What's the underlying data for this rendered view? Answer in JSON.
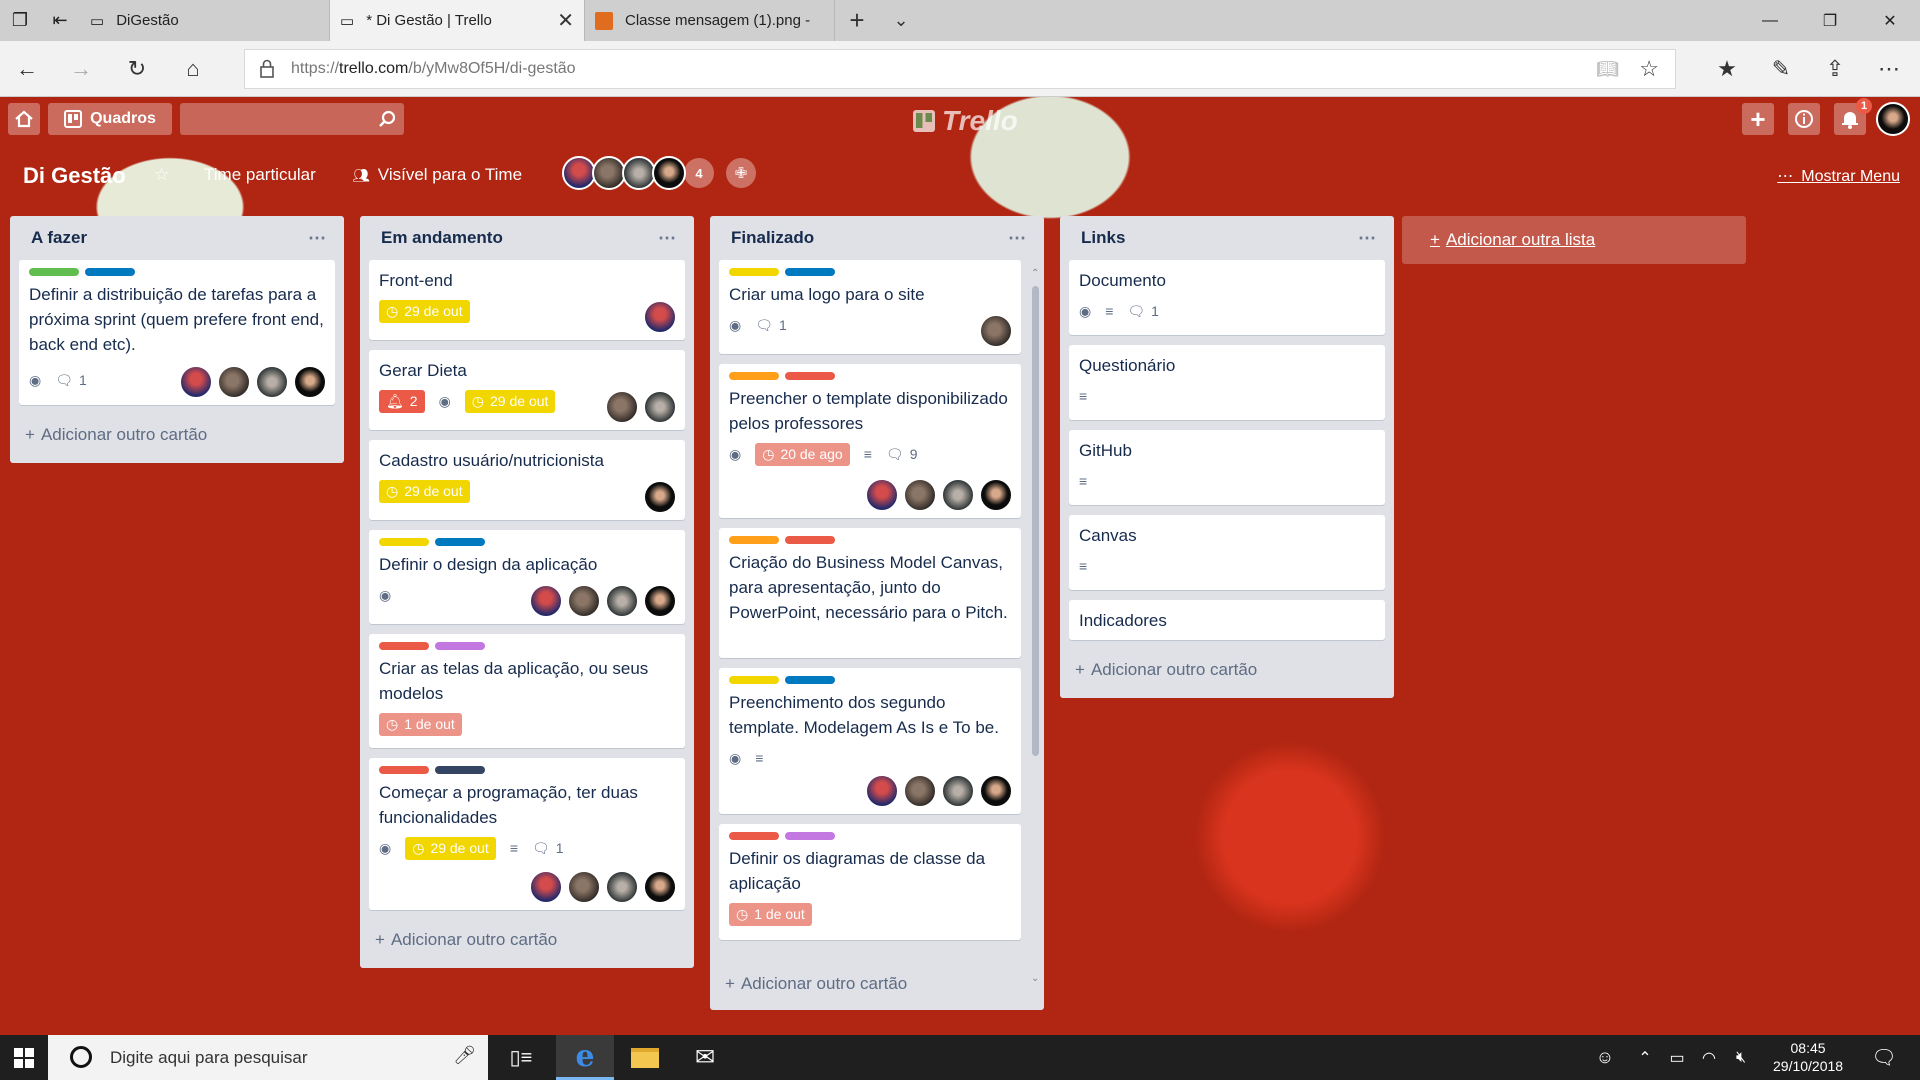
{
  "browser": {
    "tabs": [
      {
        "title": "DiGestão"
      },
      {
        "title": "* Di Gestão | Trello",
        "active": true
      },
      {
        "title": "Classe mensagem (1).png -"
      }
    ],
    "url_prefix": "https://",
    "url_host": "trello.com",
    "url_path": "/b/yMw8Of5H/di-gestão"
  },
  "header": {
    "boards_label": "Quadros",
    "logo_text": "Trello",
    "notification_count": "1"
  },
  "board": {
    "name": "Di Gestão",
    "team": "Time particular",
    "visibility": "Visível para o Time",
    "member_extra": "4",
    "menu_label": "Mostrar Menu",
    "add_list": "Adicionar outra lista",
    "add_card": "Adicionar outro cartão"
  },
  "lists": [
    {
      "title": "A fazer",
      "cards": [
        {
          "title": "Definir a distribuição de tarefas para a próxima sprint (quem prefere front end, back end etc).",
          "comments": "1"
        }
      ]
    },
    {
      "title": "Em andamento",
      "cards": [
        {
          "title": "Front-end",
          "due": "29 de out"
        },
        {
          "title": "Gerar Dieta",
          "alert": "2",
          "due": "29 de out"
        },
        {
          "title": "Cadastro usuário/nutricionista",
          "due": "29 de out"
        },
        {
          "title": "Definir o design da aplicação"
        },
        {
          "title": "Criar as telas da aplicação, ou seus modelos",
          "due": "1 de out"
        },
        {
          "title": "Começar a programação, ter duas funcionalidades",
          "due": "29 de out",
          "comments": "1"
        }
      ]
    },
    {
      "title": "Finalizado",
      "cards": [
        {
          "title": "Criar uma logo para o site",
          "comments": "1"
        },
        {
          "title": "Preencher o template disponibilizado pelos professores",
          "due": "20 de ago",
          "comments": "9"
        },
        {
          "title": "Criação do Business Model Canvas, para apresentação, junto do PowerPoint, necessário para o Pitch."
        },
        {
          "title": "Preenchimento dos segundo template. Modelagem As Is e To be."
        },
        {
          "title": "Definir os diagramas de classe da aplicação",
          "due": "1 de out"
        }
      ]
    },
    {
      "title": "Links",
      "cards": [
        {
          "title": "Documento",
          "comments": "1"
        },
        {
          "title": "Questionário"
        },
        {
          "title": "GitHub"
        },
        {
          "title": "Canvas"
        },
        {
          "title": "Indicadores"
        }
      ]
    }
  ],
  "label_colors": {
    "green": "#61bd4f",
    "blue": "#0079bf",
    "yellow": "#f2d600",
    "orange": "#ff9f1a",
    "red": "#eb5a46",
    "purple": "#c377e0",
    "navy": "#344563"
  },
  "taskbar": {
    "search_placeholder": "Digite aqui para pesquisar",
    "time": "08:45",
    "date": "29/10/2018"
  }
}
